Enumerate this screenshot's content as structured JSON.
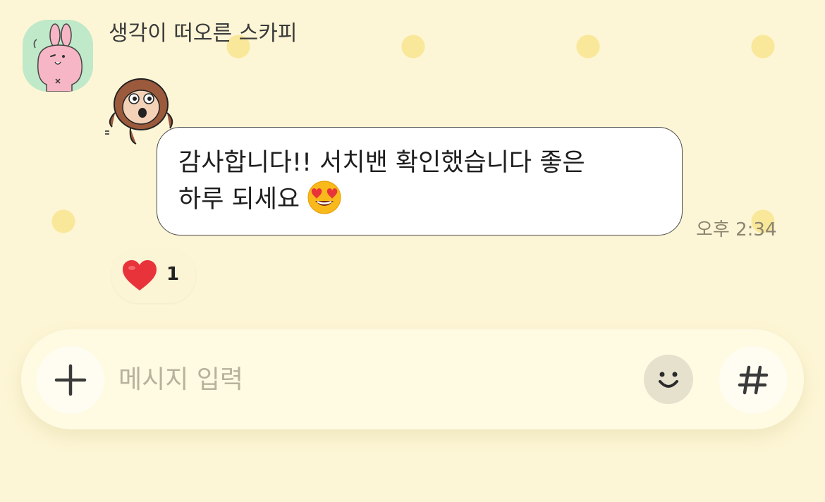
{
  "chat": {
    "sender_name": "생각이 떠오른 스카피",
    "message": {
      "line1": "감사합니다!! 서치밴 확인했습니다 좋은",
      "line2": "하루 되세요",
      "emoji": "heart-eyes-emoji",
      "time": "오후 2:34"
    },
    "reaction": {
      "icon": "heart-icon",
      "count": "1"
    }
  },
  "composer": {
    "placeholder": "메시지 입력",
    "value": "",
    "plus_icon": "plus-icon",
    "emoji_icon": "smiley-icon",
    "hash_icon": "hash-icon"
  },
  "colors": {
    "background": "#fdf6d6",
    "dots": "#f9e79a",
    "bubble": "#ffffff",
    "heart": "#e8333a"
  }
}
